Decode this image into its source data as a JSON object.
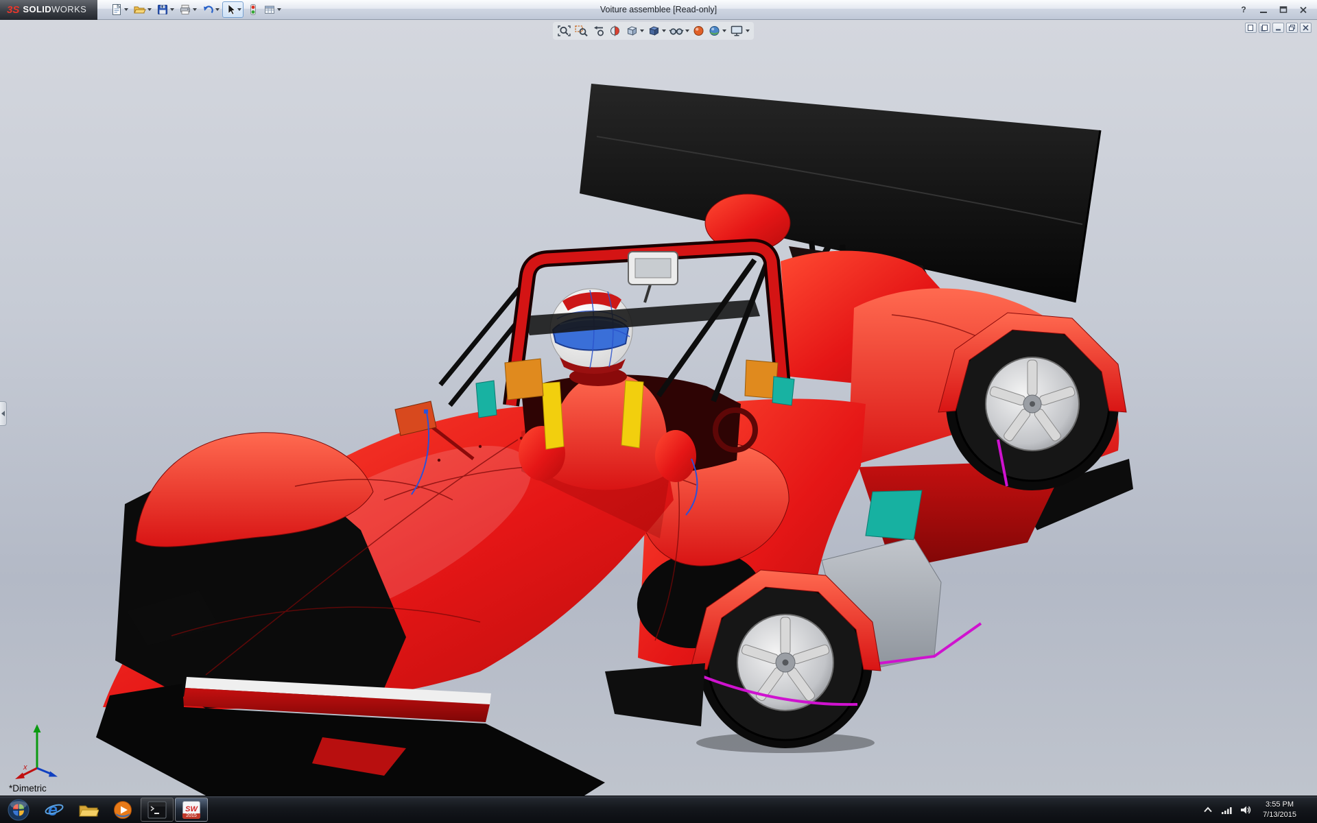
{
  "titlebar": {
    "brand_mark": "3S",
    "brand_solid": "SOLID",
    "brand_works": "WORKS",
    "title": "Voiture assemblee [Read-only]",
    "help_label": "?",
    "toolbar_icons": [
      {
        "name": "new-document"
      },
      {
        "name": "open-folder"
      },
      {
        "name": "save"
      },
      {
        "name": "print"
      },
      {
        "name": "undo"
      },
      {
        "name": "select-cursor",
        "state": "selected"
      },
      {
        "name": "rebuild"
      },
      {
        "name": "options"
      }
    ]
  },
  "hud_toolbar": {
    "icons": [
      {
        "name": "zoom-to-fit"
      },
      {
        "name": "zoom-to-area"
      },
      {
        "name": "previous-view"
      },
      {
        "name": "section-view"
      },
      {
        "name": "view-orientation",
        "dropdown": true
      },
      {
        "name": "display-style",
        "dropdown": true
      },
      {
        "name": "hide-show-items",
        "dropdown": true
      },
      {
        "name": "edit-appearance"
      },
      {
        "name": "apply-scene",
        "dropdown": true
      },
      {
        "name": "view-settings",
        "dropdown": true
      }
    ]
  },
  "doc_controls": [
    "previous-window",
    "next-window",
    "minimize-document",
    "restore-document",
    "close-document"
  ],
  "viewport": {
    "view_orientation_label": "*Dimetric",
    "triad_x_label": "x",
    "model_description": "red prototype race car assembly with rear wing and driver"
  },
  "taskbar": {
    "items": [
      {
        "name": "start-button"
      },
      {
        "name": "internet-explorer"
      },
      {
        "name": "file-explorer"
      },
      {
        "name": "windows-media-player"
      },
      {
        "name": "command-prompt",
        "state": "running"
      },
      {
        "name": "solidworks-2015",
        "state": "active"
      }
    ],
    "ie_glyph": "e",
    "sw_glyph": "SW",
    "sw_year": "2015",
    "tray_icons": [
      "hidden-icons",
      "network",
      "volume"
    ],
    "clock_time": "3:55 PM",
    "clock_date": "7/13/2015"
  },
  "colors": {
    "body_red": "#e51616",
    "wing_black": "#0a0a0a",
    "accent_teal": "#17b1a1",
    "accent_magenta": "#cf12cf",
    "viewport_top": "#d4d7de",
    "viewport_bottom": "#b3b9c6"
  }
}
